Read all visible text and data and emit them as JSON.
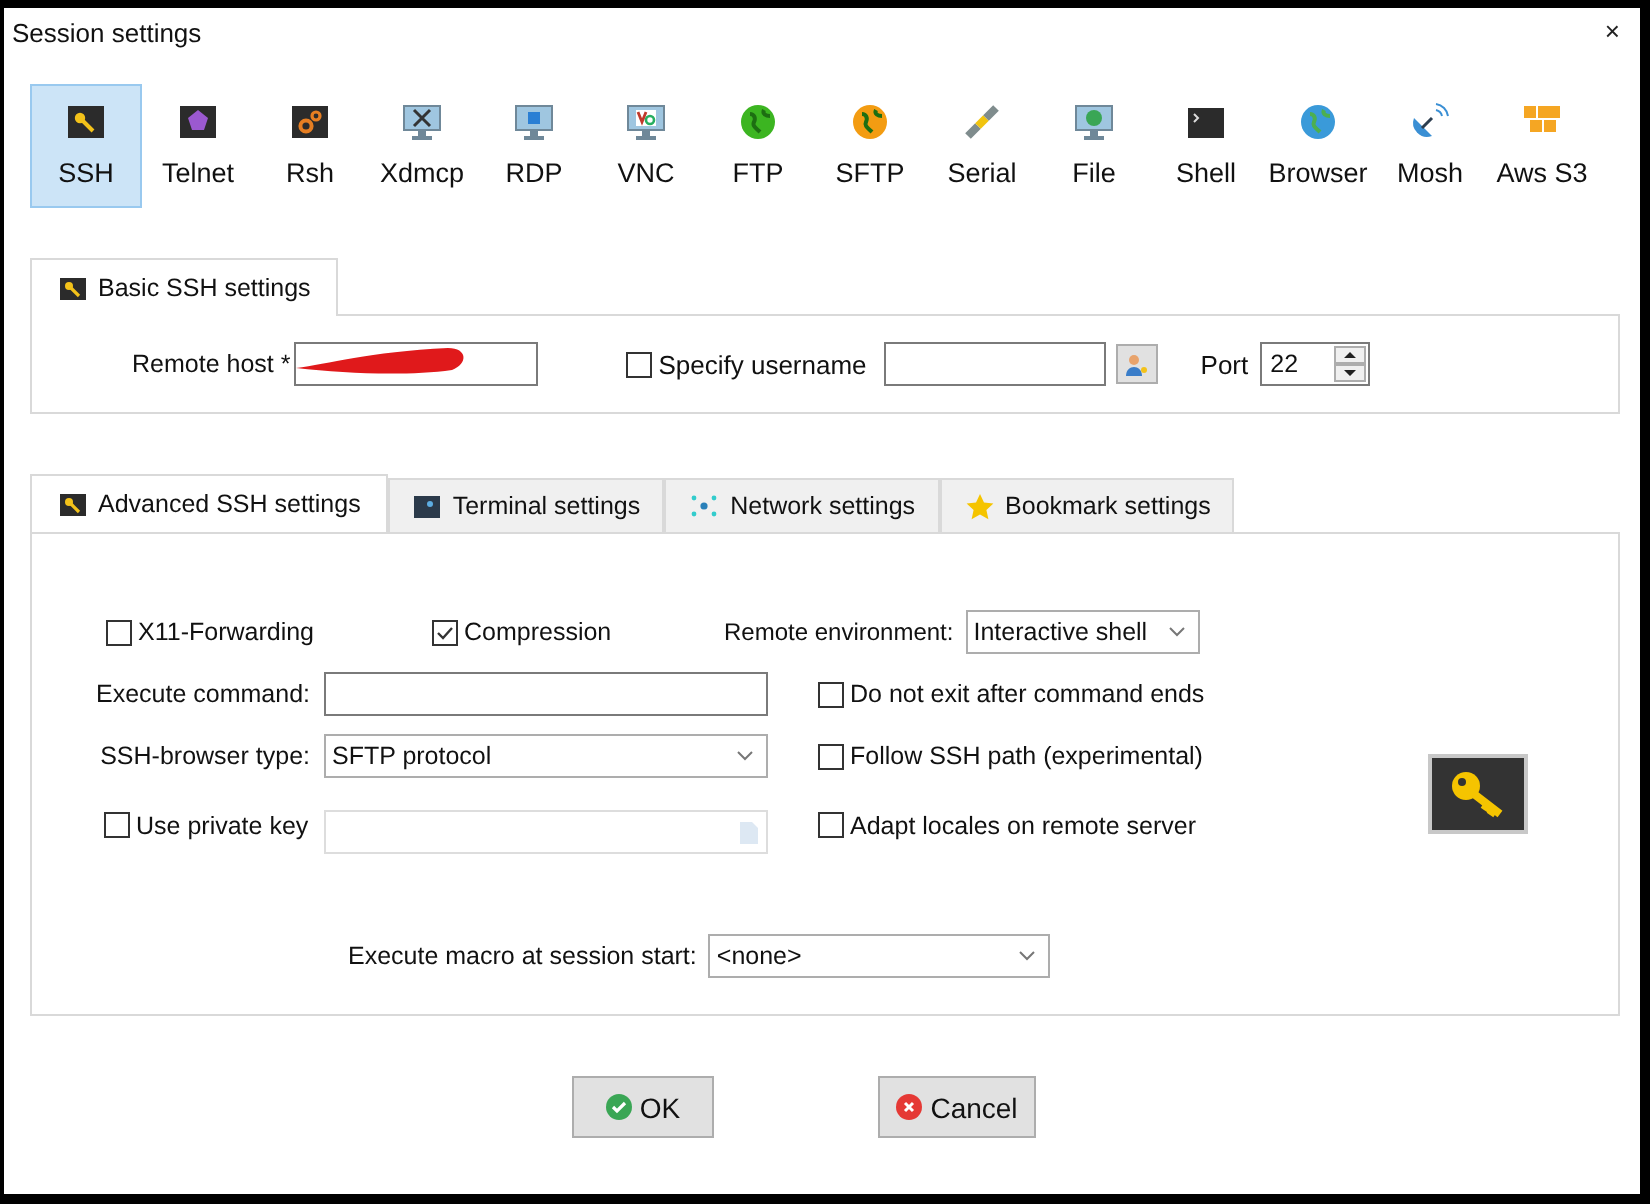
{
  "window": {
    "title": "Session settings",
    "close": "×"
  },
  "protocols": [
    {
      "label": "SSH",
      "kind": "ssh",
      "selected": true
    },
    {
      "label": "Telnet",
      "kind": "telnet",
      "selected": false
    },
    {
      "label": "Rsh",
      "kind": "rsh",
      "selected": false
    },
    {
      "label": "Xdmcp",
      "kind": "xdmcp",
      "selected": false
    },
    {
      "label": "RDP",
      "kind": "rdp",
      "selected": false
    },
    {
      "label": "VNC",
      "kind": "vnc",
      "selected": false
    },
    {
      "label": "FTP",
      "kind": "ftp",
      "selected": false
    },
    {
      "label": "SFTP",
      "kind": "sftp",
      "selected": false
    },
    {
      "label": "Serial",
      "kind": "serial",
      "selected": false
    },
    {
      "label": "File",
      "kind": "file",
      "selected": false
    },
    {
      "label": "Shell",
      "kind": "shell",
      "selected": false
    },
    {
      "label": "Browser",
      "kind": "browser",
      "selected": false
    },
    {
      "label": "Mosh",
      "kind": "mosh",
      "selected": false
    },
    {
      "label": "Aws S3",
      "kind": "aws",
      "selected": false
    }
  ],
  "basic": {
    "tab": "Basic SSH settings",
    "remote_host": {
      "label": "Remote host *"
    },
    "specify_username": {
      "label": "Specify username",
      "checked": false
    },
    "port": {
      "label": "Port",
      "value": "22"
    }
  },
  "advanced": {
    "tabs": [
      {
        "label": "Advanced SSH settings",
        "kind": "key",
        "selected": true
      },
      {
        "label": "Terminal settings",
        "kind": "terminal",
        "selected": false
      },
      {
        "label": "Network settings",
        "kind": "network",
        "selected": false
      },
      {
        "label": "Bookmark settings",
        "kind": "star",
        "selected": false
      }
    ],
    "x11_forwarding": {
      "label": "X11-Forwarding",
      "checked": false
    },
    "compression": {
      "label": "Compression",
      "checked": true
    },
    "remote_environment": {
      "label": "Remote environment:",
      "value": "Interactive shell"
    },
    "execute_command": {
      "label": "Execute command:"
    },
    "ssh_browser_type": {
      "label": "SSH-browser type:",
      "value": "SFTP protocol"
    },
    "use_private_key": {
      "label": "Use private key",
      "checked": false
    },
    "options": [
      {
        "label": "Do not exit after command ends",
        "checked": false
      },
      {
        "label": "Follow SSH path (experimental)",
        "checked": false
      },
      {
        "label": "Adapt locales on remote server",
        "checked": false
      }
    ],
    "macro": {
      "label": "Execute macro at session start:",
      "value": "<none>"
    }
  },
  "buttons": [
    {
      "label": "OK",
      "kind": "ok"
    },
    {
      "label": "Cancel",
      "kind": "cancel"
    }
  ]
}
